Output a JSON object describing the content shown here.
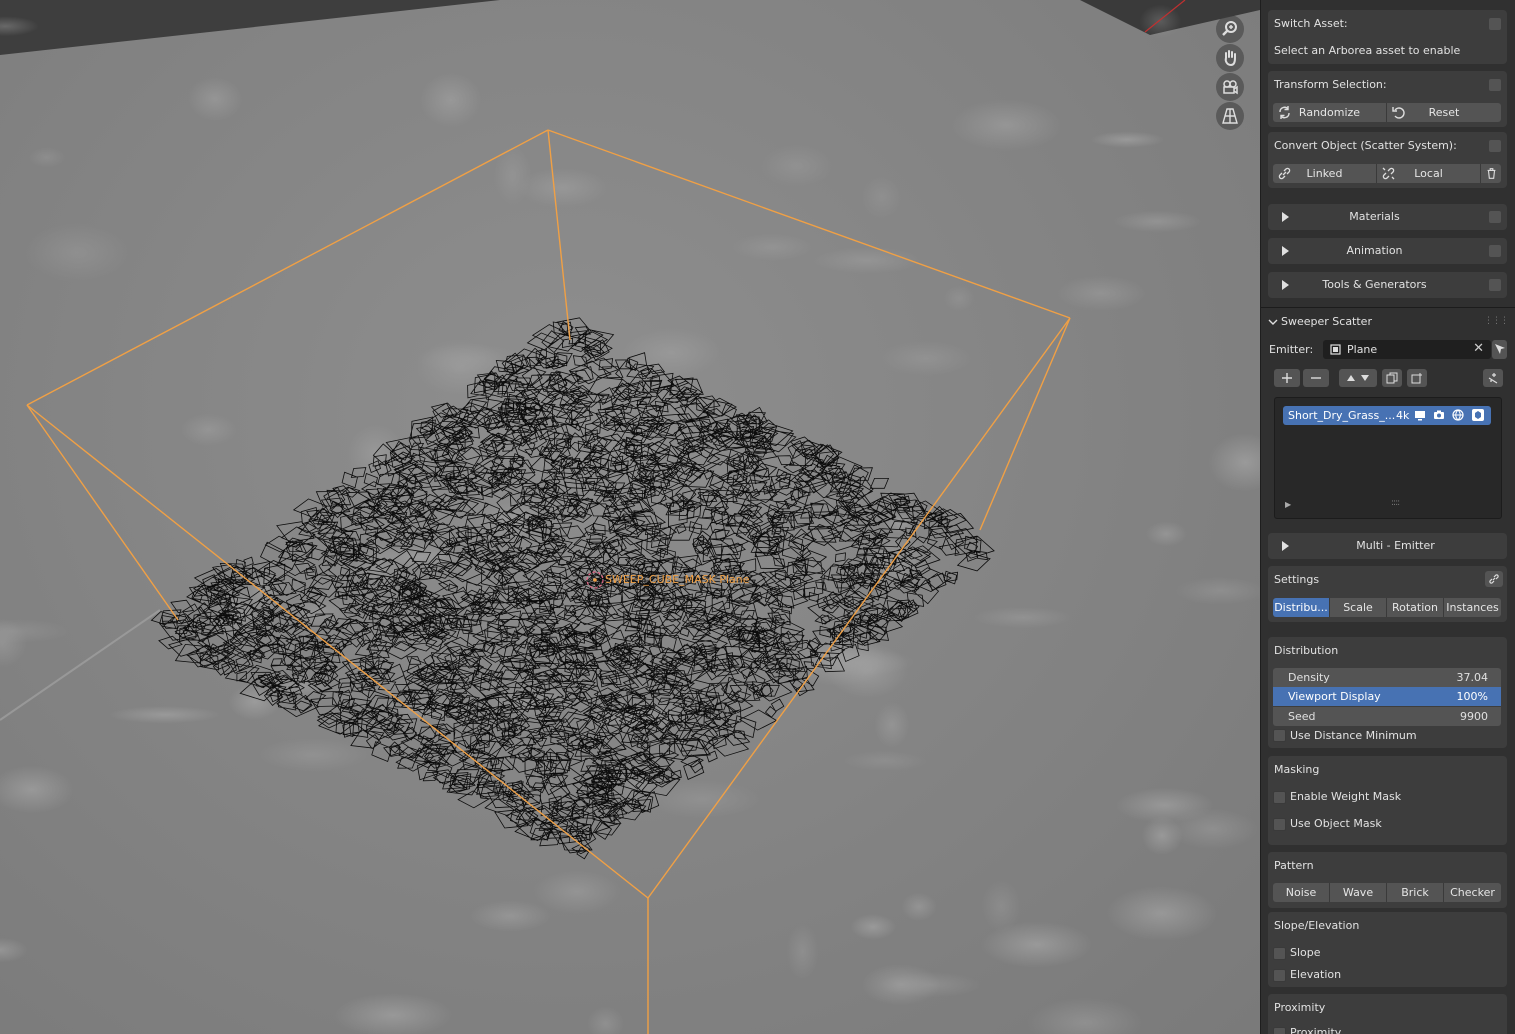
{
  "viewport": {
    "object_label": "SWEEP_CUBE_MASK Plane",
    "nav_icons": [
      "zoom-icon",
      "pan-hand-icon",
      "camera-icon",
      "perspective-grid-icon"
    ],
    "colors": {
      "selection": "#f0a045",
      "wire": "#0c0c0c",
      "ground": "#858585"
    }
  },
  "switch_asset": {
    "title": "Switch Asset:",
    "hint": "Select an Arborea asset to enable"
  },
  "transform_selection": {
    "title": "Transform Selection:",
    "randomize": "Randomize",
    "reset": "Reset"
  },
  "convert_object": {
    "title": "Convert Object (Scatter System):",
    "linked": "Linked",
    "local": "Local"
  },
  "collapsed": {
    "materials": "Materials",
    "animation": "Animation",
    "tools": "Tools & Generators",
    "multi_emitter": "Multi - Emitter"
  },
  "sweeper": {
    "title": "Sweeper Scatter",
    "emitter_label": "Emitter:",
    "emitter_value": "Plane",
    "list_item": {
      "name": "Short_Dry_Grass_...",
      "count": "4k"
    }
  },
  "settings": {
    "title": "Settings",
    "tabs": [
      "Distribu...",
      "Scale",
      "Rotation",
      "Instances"
    ]
  },
  "distribution": {
    "title": "Distribution",
    "density_label": "Density",
    "density_value": "37.04",
    "viewport_label": "Viewport Display",
    "viewport_value": "100%",
    "seed_label": "Seed",
    "seed_value": "9900",
    "use_distance_min": "Use Distance Minimum"
  },
  "masking": {
    "title": "Masking",
    "weight_mask": "Enable Weight Mask",
    "object_mask": "Use Object Mask"
  },
  "pattern": {
    "title": "Pattern",
    "buttons": [
      "Noise",
      "Wave",
      "Brick",
      "Checker"
    ]
  },
  "slope_elevation": {
    "title": "Slope/Elevation",
    "slope": "Slope",
    "elevation": "Elevation"
  },
  "proximity": {
    "title": "Proximity",
    "item": "Proximity"
  },
  "accent": "#4772b3"
}
